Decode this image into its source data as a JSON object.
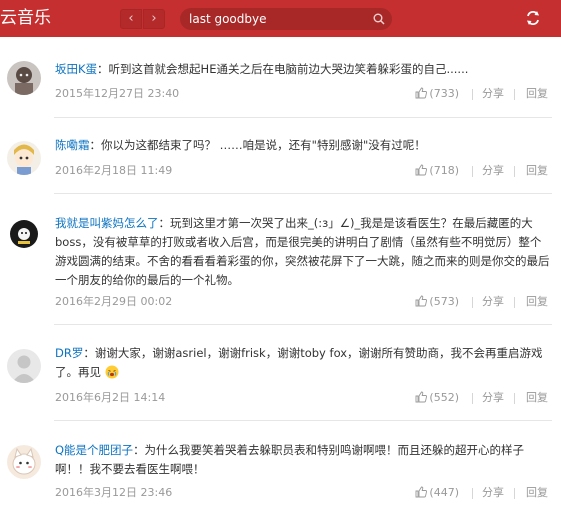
{
  "app": {
    "logo_text": "云音乐",
    "search_value": "last goodbye",
    "nav_back": "‹",
    "nav_forward": "›"
  },
  "colors": {
    "brand_red": "#c62f2f",
    "username_blue": "#0c73c2",
    "meta_gray": "#999999"
  },
  "comments": [
    {
      "username": "坂田K蛋",
      "text": "：听到这首就会想起HE通关之后在电脑前边大哭边笑着躲彩蛋的自己......",
      "time": "2015年12月27日 23:40",
      "likes": "(733)",
      "share": "分享",
      "reply": "回复"
    },
    {
      "username": "陈嘞霜",
      "text": "：你以为这都结束了吗？ ……咱是说，还有\"特别感谢\"没有过呢！",
      "time": "2016年2月18日 11:49",
      "likes": "(718)",
      "share": "分享",
      "reply": "回复"
    },
    {
      "username": "我就是叫紫妈怎么了",
      "text": "：玩到这里才第一次哭了出来_(:з」∠)_我是是该看医生？在最后藏匿的大boss，没有被草草的打败或者收入后宫，而是很完美的讲明白了剧情（虽然有些不明觉厉）整个游戏圆满的结束。不舍的看看看着彩蛋的你，突然被花屏下了一大跳，随之而来的则是你交的最后一个朋友的给你的最后的一个礼物。",
      "time": "2016年2月29日 00:02",
      "likes": "(573)",
      "share": "分享",
      "reply": "回复"
    },
    {
      "username": "DR罗",
      "text": "：谢谢大家，谢谢asriel，谢谢frisk，谢谢toby fox，谢谢所有赞助商，我不会再重启游戏了。再见",
      "time": "2016年6月2日 14:14",
      "likes": "(552)",
      "share": "分享",
      "reply": "回复"
    },
    {
      "username": "Q能是个肥团子",
      "text": "：为什么我要笑着哭着去躲职员表和特别鸣谢啊喂！而且还躲的超开心的样子啊！！我不要去看医生啊喂！",
      "time": "2016年3月12日 23:46",
      "likes": "(447)",
      "share": "分享",
      "reply": "回复"
    }
  ]
}
